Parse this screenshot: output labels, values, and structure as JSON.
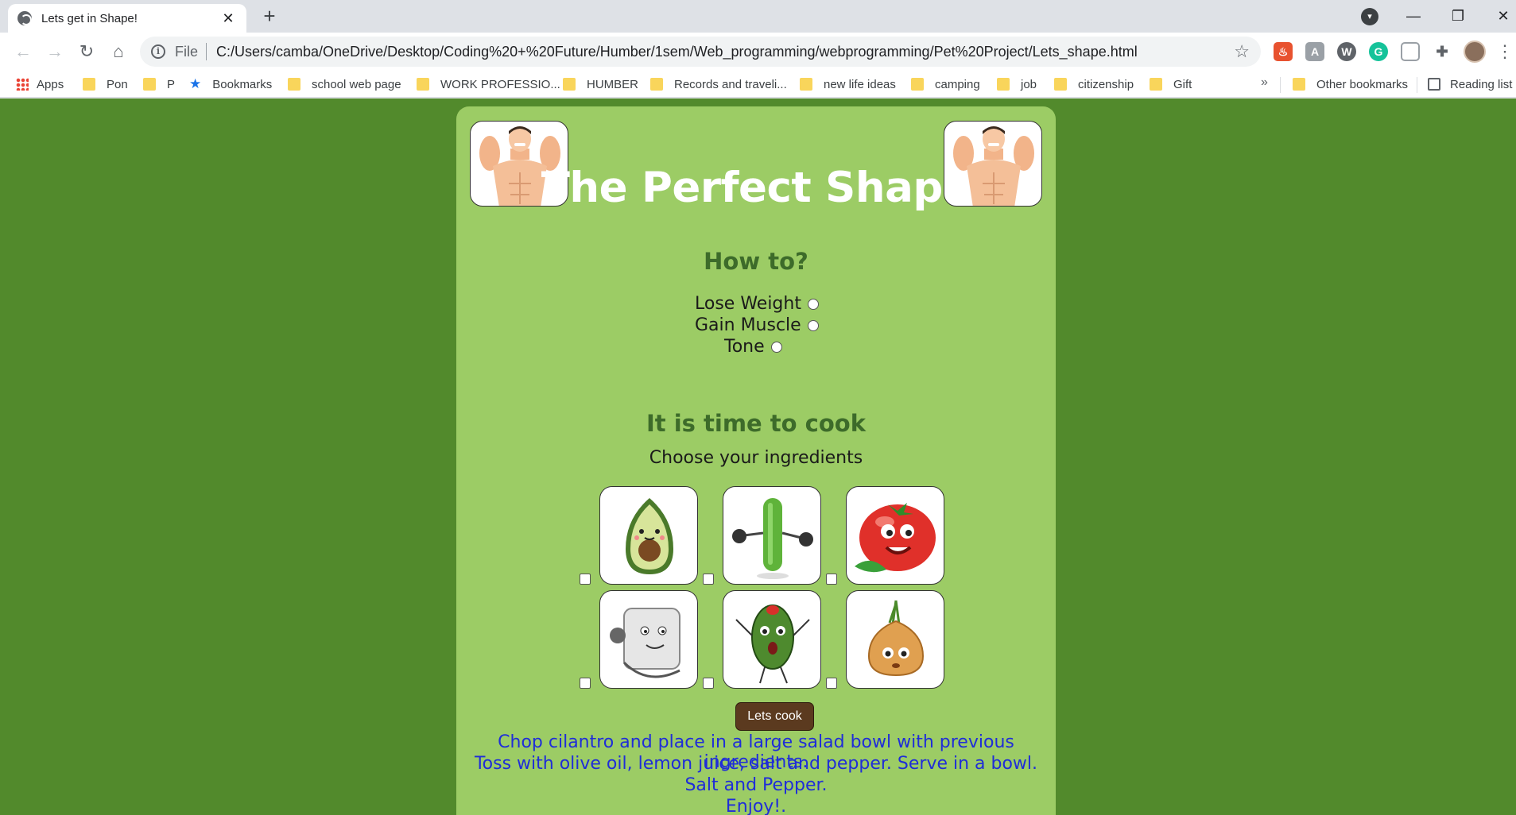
{
  "browser": {
    "tab_title": "Lets get in Shape!",
    "tab_close": "✕",
    "new_tab": "+",
    "scheme": "File",
    "url": "C:/Users/camba/OneDrive/Desktop/Coding%20+%20Future/Humber/1sem/Web_programming/webprogramming/Pet%20Project/Lets_shape.html",
    "window_controls": {
      "minimize": "—",
      "maximize": "❐",
      "close": "✕"
    },
    "extensions": [
      "fire-extension-icon",
      "translate-extension-icon",
      "wordtune-extension-icon",
      "grammarly-extension-icon",
      "clipboard-extension-icon",
      "puzzle-extensions-icon"
    ]
  },
  "bookmarks": {
    "apps": "Apps",
    "items": [
      "Pon",
      "P",
      "Bookmarks",
      "school web page",
      "WORK PROFESSIO...",
      "HUMBER",
      "Records and traveli...",
      "new life ideas",
      "camping",
      "job",
      "citizenship",
      "Gift"
    ],
    "overflow": "»",
    "other": "Other bookmarks",
    "reading_list": "Reading list"
  },
  "page": {
    "title": "The Perfect Shape",
    "how_heading": "How to?",
    "goals": [
      "Lose Weight",
      "Gain Muscle",
      "Tone"
    ],
    "cook_heading": "It is time to cook",
    "ingredients_prompt": "Choose your ingredients",
    "ingredients": [
      "avocado",
      "cucumber",
      "tomato",
      "grater",
      "olive",
      "onion"
    ],
    "cook_button": "Lets cook",
    "recipe_lines": [
      "Chop cilantro and place in a large salad bowl with previous ingredients.",
      "Toss with olive oil, lemon juice, salt and pepper. Serve in a bowl.",
      "Salt and Pepper.",
      "Enjoy!."
    ]
  },
  "colors": {
    "page_background": "#528a2c",
    "card_background": "#9ccc65",
    "heading_green": "#3d6b2a",
    "recipe_blue": "#1f2dd8",
    "button_brown": "#5b3a1f"
  }
}
